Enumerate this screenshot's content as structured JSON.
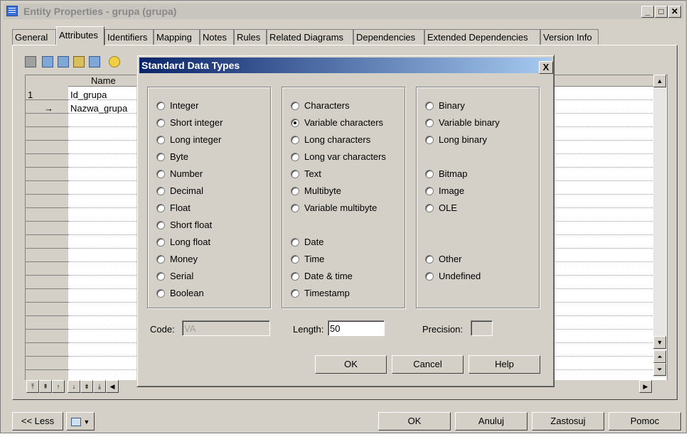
{
  "window": {
    "title": "Entity Properties - grupa (grupa)"
  },
  "tabs": [
    "General",
    "Attributes",
    "Identifiers",
    "Mapping",
    "Notes",
    "Rules",
    "Related Diagrams",
    "Dependencies",
    "Extended Dependencies",
    "Version Info"
  ],
  "active_tab": "Attributes",
  "grid": {
    "column_header": "Name",
    "rows": [
      {
        "marker": "1",
        "name": "Id_grupa"
      },
      {
        "marker": "→",
        "name": "Nazwa_grupa"
      }
    ]
  },
  "footer": {
    "less_label": "<< Less",
    "ok_label": "OK",
    "cancel_label": "Anuluj",
    "apply_label": "Zastosuj",
    "help_label": "Pomoc"
  },
  "dialog": {
    "title": "Standard Data Types",
    "close_glyph": "X",
    "numeric": [
      "Integer",
      "Short integer",
      "Long integer",
      "Byte",
      "Number",
      "Decimal",
      "Float",
      "Short float",
      "Long float",
      "Money",
      "Serial",
      "Boolean"
    ],
    "text": [
      "Characters",
      "Variable characters",
      "Long characters",
      "Long var characters",
      "Text",
      "Multibyte",
      "Variable multibyte"
    ],
    "datetime": [
      "Date",
      "Time",
      "Date & time",
      "Timestamp"
    ],
    "binary": [
      "Binary",
      "Variable binary",
      "Long binary"
    ],
    "media": [
      "Bitmap",
      "Image",
      "OLE"
    ],
    "other": [
      "Other",
      "Undefined"
    ],
    "selected": "Variable characters",
    "code_label": "Code:",
    "code_value": "VA",
    "length_label": "Length:",
    "length_value": "50",
    "precision_label": "Precision:",
    "precision_value": "",
    "ok_label": "OK",
    "cancel_label": "Cancel",
    "help_label": "Help"
  }
}
